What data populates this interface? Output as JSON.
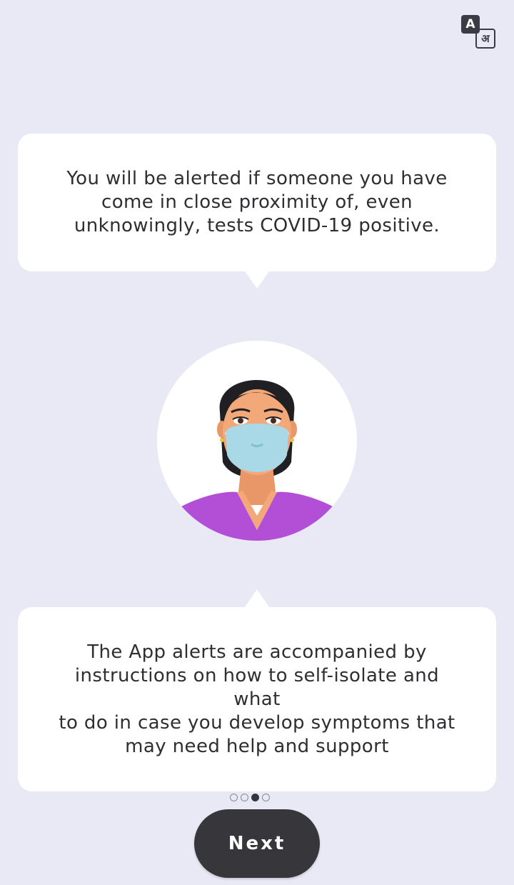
{
  "language_button": {
    "icon": "translate-icon",
    "latin_glyph": "A",
    "devanagari_glyph": "अ"
  },
  "top_bubble": {
    "text": "You will be alerted if someone you have\ncome in close proximity of, even\nunknowingly, tests COVID-19 positive."
  },
  "illustration": {
    "icon": "masked-woman-illustration"
  },
  "bottom_bubble": {
    "text": "The App alerts are accompanied by\ninstructions on how to self-isolate and\nwhat\nto do in case you develop symptoms that\nmay need help and support"
  },
  "pagination": {
    "total": 4,
    "active_index": 2
  },
  "next_button": {
    "label": "Next"
  },
  "colors": {
    "background": "#e9e9f6",
    "button": "#36363b",
    "mask": "#a9d8e6",
    "shirt": "#b24fd6",
    "skin": "#f2a878"
  }
}
